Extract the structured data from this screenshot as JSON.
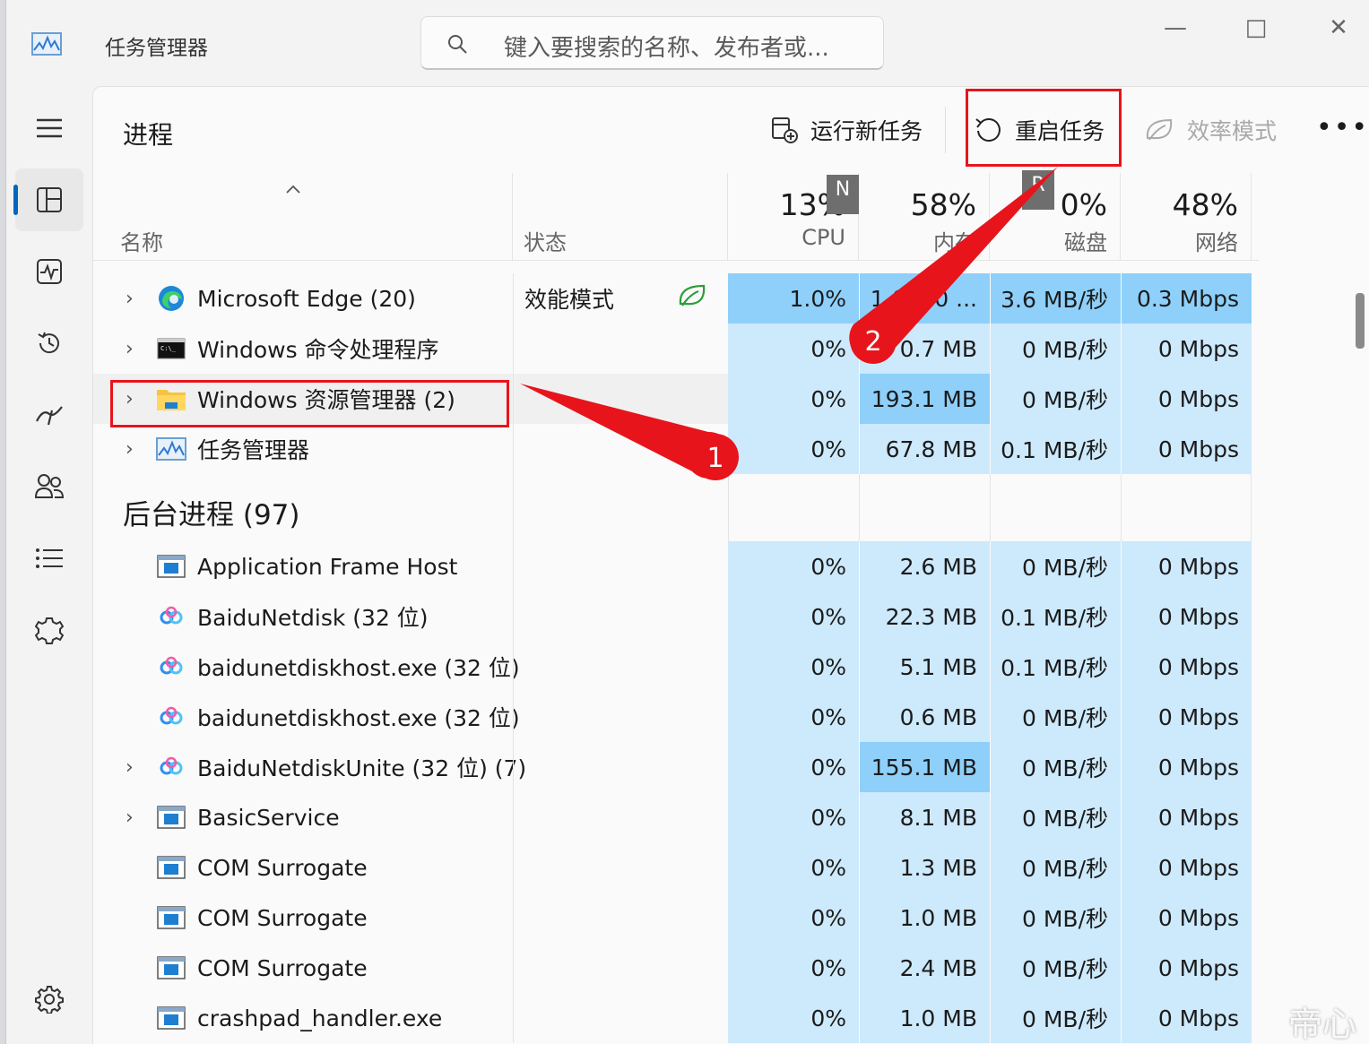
{
  "window": {
    "title": "任务管理器",
    "search_placeholder": "键入要搜索的名称、发布者或...",
    "minimize": "—",
    "maximize": "□",
    "close": "✕"
  },
  "sidebar": {
    "items": [
      {
        "name": "processes",
        "icon": "processes-icon",
        "active": true
      },
      {
        "name": "performance",
        "icon": "performance-icon"
      },
      {
        "name": "app-history",
        "icon": "history-icon"
      },
      {
        "name": "startup-apps",
        "icon": "startup-icon"
      },
      {
        "name": "users",
        "icon": "users-icon"
      },
      {
        "name": "details",
        "icon": "details-icon"
      },
      {
        "name": "services",
        "icon": "services-icon"
      }
    ],
    "settings_icon": "settings-icon"
  },
  "commandbar": {
    "page_title": "进程",
    "run_new_task": "运行新任务",
    "restart_task": "重启任务",
    "efficiency_mode": "效率模式",
    "more": "•••"
  },
  "columns": {
    "name": "名称",
    "status": "状态",
    "cpu": {
      "value": "13%",
      "label": "CPU",
      "overlay": "N"
    },
    "memory": {
      "value": "58%",
      "label": "内存",
      "overlay": "R"
    },
    "disk": {
      "value": "0%",
      "label": "磁盘"
    },
    "network": {
      "value": "48%",
      "label": "网络"
    }
  },
  "apps": [
    {
      "name": "Microsoft Edge (20)",
      "status": "效能模式",
      "cpu": "1.0%",
      "memory": "1,0... 0 ...",
      "disk": "3.6 MB/秒",
      "network": "0.3 Mbps",
      "icon": "edge-icon"
    },
    {
      "name": "Windows 命令处理程序",
      "status": "",
      "cpu": "0%",
      "memory": "0.7 MB",
      "disk": "0 MB/秒",
      "network": "0 Mbps",
      "icon": "cmd-icon"
    },
    {
      "name": "Windows 资源管理器 (2)",
      "status": "",
      "cpu": "0%",
      "memory": "193.1 MB",
      "disk": "0 MB/秒",
      "network": "0 Mbps",
      "icon": "folder-icon"
    },
    {
      "name": "任务管理器",
      "status": "",
      "cpu": "0%",
      "memory": "67.8 MB",
      "disk": "0.1 MB/秒",
      "network": "0 Mbps",
      "icon": "taskmgr-icon"
    }
  ],
  "background_group": "后台进程 (97)",
  "background": [
    {
      "name": "Application Frame Host",
      "cpu": "0%",
      "memory": "2.6 MB",
      "disk": "0 MB/秒",
      "network": "0 Mbps",
      "icon": "window-icon",
      "expand": false
    },
    {
      "name": "BaiduNetdisk (32 位)",
      "cpu": "0%",
      "memory": "22.3 MB",
      "disk": "0.1 MB/秒",
      "network": "0 Mbps",
      "icon": "baidu-icon",
      "expand": false
    },
    {
      "name": "baidunetdiskhost.exe (32 位)",
      "cpu": "0%",
      "memory": "5.1 MB",
      "disk": "0.1 MB/秒",
      "network": "0 Mbps",
      "icon": "baidu-icon",
      "expand": false
    },
    {
      "name": "baidunetdiskhost.exe (32 位)",
      "cpu": "0%",
      "memory": "0.6 MB",
      "disk": "0 MB/秒",
      "network": "0 Mbps",
      "icon": "baidu-icon",
      "expand": false
    },
    {
      "name": "BaiduNetdiskUnite (32 位) (7)",
      "cpu": "0%",
      "memory": "155.1 MB",
      "disk": "0 MB/秒",
      "network": "0 Mbps",
      "icon": "baidu-icon",
      "expand": true
    },
    {
      "name": "BasicService",
      "cpu": "0%",
      "memory": "8.1 MB",
      "disk": "0 MB/秒",
      "network": "0 Mbps",
      "icon": "window-icon",
      "expand": true
    },
    {
      "name": "COM Surrogate",
      "cpu": "0%",
      "memory": "1.3 MB",
      "disk": "0 MB/秒",
      "network": "0 Mbps",
      "icon": "window-icon",
      "expand": false
    },
    {
      "name": "COM Surrogate",
      "cpu": "0%",
      "memory": "1.0 MB",
      "disk": "0 MB/秒",
      "network": "0 Mbps",
      "icon": "window-icon",
      "expand": false
    },
    {
      "name": "COM Surrogate",
      "cpu": "0%",
      "memory": "2.4 MB",
      "disk": "0 MB/秒",
      "network": "0 Mbps",
      "icon": "window-icon",
      "expand": false
    },
    {
      "name": "crashpad_handler.exe",
      "cpu": "0%",
      "memory": "1.0 MB",
      "disk": "0 MB/秒",
      "network": "0 Mbps",
      "icon": "window-icon",
      "expand": false
    }
  ],
  "annotations": {
    "marker1": "1",
    "marker2": "2",
    "color": "#e8141b"
  },
  "watermark": "帝心",
  "colors": {
    "accent": "#0067c0",
    "heat_light": "#cde9fc",
    "heat_medium": "#8ed0fa",
    "efficiency_green": "#2a9d3a"
  }
}
